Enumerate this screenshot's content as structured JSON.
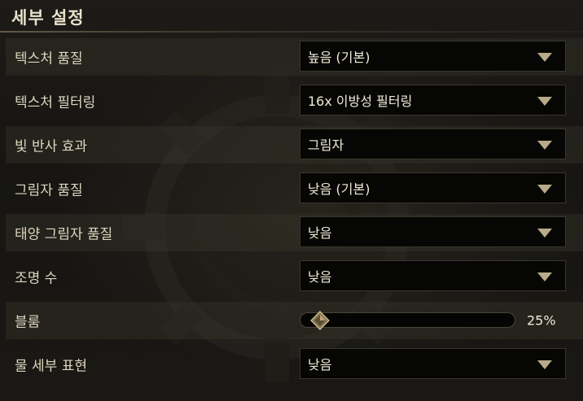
{
  "panel": {
    "title": "세부 설정"
  },
  "settings": [
    {
      "label": "텍스처 품질",
      "value": "높음 (기본)",
      "type": "dropdown"
    },
    {
      "label": "텍스처 필터링",
      "value": "16x 이방성 필터링",
      "type": "dropdown"
    },
    {
      "label": "빛 반사 효과",
      "value": "그림자",
      "type": "dropdown"
    },
    {
      "label": "그림자 품질",
      "value": "낮음 (기본)",
      "type": "dropdown"
    },
    {
      "label": "태양 그림자 품질",
      "value": "낮음",
      "type": "dropdown"
    },
    {
      "label": "조명 수",
      "value": "낮음",
      "type": "dropdown"
    },
    {
      "label": "블룸",
      "value_text": "25%",
      "level": 0.05,
      "type": "slider"
    },
    {
      "label": "물 세부 표현",
      "value": "낮음",
      "type": "dropdown"
    }
  ],
  "icons": {
    "dropdown": "chevron-down-icon",
    "slider_handle": "diamond-handle-icon",
    "background": "gear-emblem-icon"
  },
  "colors": {
    "text": "#ddd6bf",
    "value_text": "#f0ebd8",
    "control_bg": "#060605",
    "accent": "#b7ab8a"
  }
}
